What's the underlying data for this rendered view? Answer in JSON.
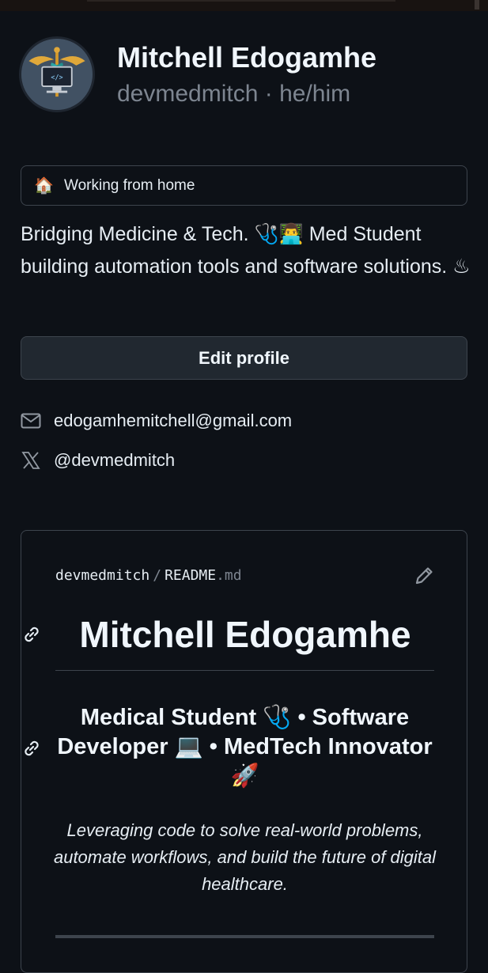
{
  "profile": {
    "name": "Mitchell Edogamhe",
    "handle": "devmedmitch",
    "separator": " · ",
    "pronouns": "he/him",
    "status": {
      "emoji": "🏠",
      "text": "Working from home"
    },
    "bio": "Bridging Medicine & Tech. 🩺👨‍💻 Med Student building automation tools and software solutions. ♨",
    "edit_button": "Edit profile",
    "email": "edogamhemitchell@gmail.com",
    "twitter": "@devmedmitch"
  },
  "readme": {
    "owner": "devmedmitch",
    "path_sep": "/",
    "file_base": "README",
    "file_ext": ".md",
    "heading": "Mitchell Edogamhe",
    "subheading": "Medical Student 🩺 • Software Developer 💻 • MedTech Innovator 🚀",
    "tagline": "Leveraging code to solve real-world problems, automate workflows, and build the future of digital healthcare."
  },
  "icons": {
    "email": "mail-icon",
    "twitter": "x-logo-icon",
    "edit": "pencil-icon",
    "anchor": "link-icon"
  },
  "colors": {
    "background": "#0d1117",
    "border": "#3d444d",
    "muted": "#7d8590",
    "text": "#e6edf3"
  }
}
